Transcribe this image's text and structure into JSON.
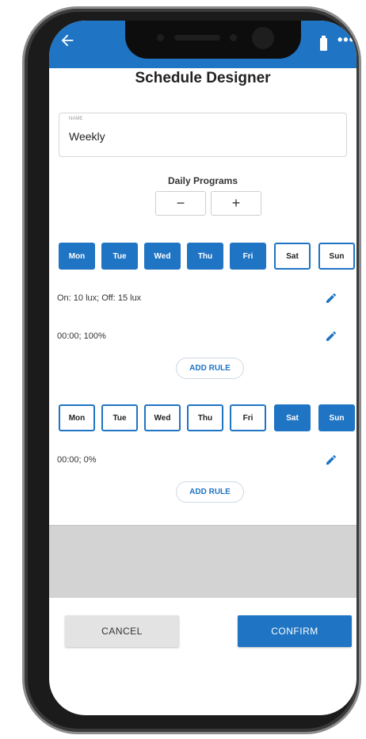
{
  "colors": {
    "primary": "#1f74c4",
    "panel_gray": "#d3d3d3"
  },
  "header": {
    "title": "Schedule Designer",
    "back_icon": "arrow-left-icon",
    "more_icon": "more-horizontal-icon"
  },
  "name_field": {
    "label": "NAME",
    "value": "Weekly"
  },
  "daily_programs": {
    "label": "Daily Programs",
    "decrement": "−",
    "increment": "+"
  },
  "programs": [
    {
      "days": [
        {
          "label": "Mon",
          "selected": true
        },
        {
          "label": "Tue",
          "selected": true
        },
        {
          "label": "Wed",
          "selected": true
        },
        {
          "label": "Thu",
          "selected": true
        },
        {
          "label": "Fri",
          "selected": true
        },
        {
          "label": "Sat",
          "selected": false
        },
        {
          "label": "Sun",
          "selected": false
        }
      ],
      "rules": [
        "On: 10 lux; Off: 15 lux",
        "00:00; 100%"
      ],
      "add_rule": "ADD RULE"
    },
    {
      "days": [
        {
          "label": "Mon",
          "selected": false
        },
        {
          "label": "Tue",
          "selected": false
        },
        {
          "label": "Wed",
          "selected": false
        },
        {
          "label": "Thu",
          "selected": false
        },
        {
          "label": "Fri",
          "selected": false
        },
        {
          "label": "Sat",
          "selected": true
        },
        {
          "label": "Sun",
          "selected": true
        }
      ],
      "rules": [
        "00:00; 0%"
      ],
      "add_rule": "ADD RULE"
    }
  ],
  "footer": {
    "cancel": "CANCEL",
    "confirm": "CONFIRM"
  }
}
